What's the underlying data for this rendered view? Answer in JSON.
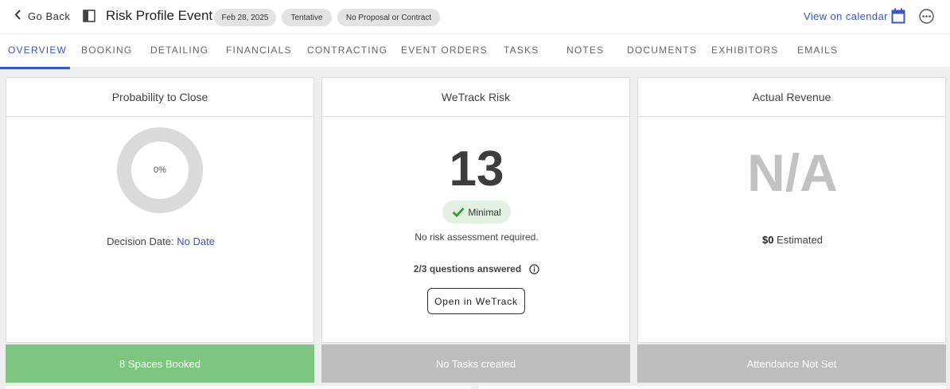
{
  "header": {
    "back_label": "Go Back",
    "title": "Risk Profile Event",
    "date_pill": "Feb 28, 2025",
    "status_pill": "Tentative",
    "proposal_pill": "No Proposal or Contract",
    "view_calendar": "View on calendar",
    "accent_color": "#3a56c5"
  },
  "tabs": [
    {
      "label": "OVERVIEW",
      "active": true
    },
    {
      "label": "BOOKING"
    },
    {
      "label": "DETAILING"
    },
    {
      "label": "FINANCIALS"
    },
    {
      "label": "CONTRACTING"
    },
    {
      "label": "EVENT ORDERS"
    },
    {
      "label": "TASKS"
    },
    {
      "label": "NOTES"
    },
    {
      "label": "DOCUMENTS"
    },
    {
      "label": "EXHIBITORS"
    },
    {
      "label": "EMAILS"
    }
  ],
  "cards": {
    "probability": {
      "title": "Probability to Close",
      "percent_label": "0%",
      "percent_value": 0,
      "decision_label": "Decision Date:",
      "decision_value": "No Date"
    },
    "risk": {
      "title": "WeTrack Risk",
      "score": "13",
      "badge": "Minimal",
      "assessment": "No risk assessment required.",
      "questions": "2/3 questions answered",
      "button": "Open in WeTrack"
    },
    "revenue": {
      "title": "Actual Revenue",
      "value": "N/A",
      "estimated_amount": "$0",
      "estimated_label": "Estimated"
    }
  },
  "status_bars": {
    "spaces": "8 Spaces Booked",
    "tasks": "No Tasks created",
    "attendance": "Attendance Not Set",
    "spaces_color": "#7dc67f",
    "neutral_color": "#bdbdbd"
  }
}
